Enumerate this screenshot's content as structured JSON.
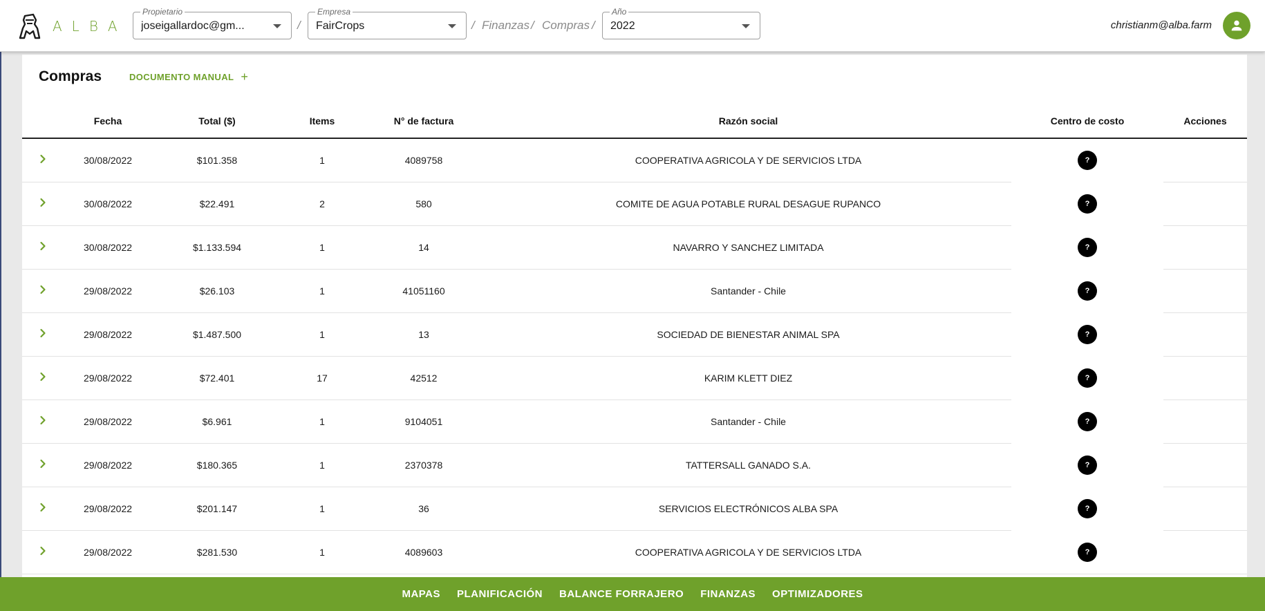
{
  "app": {
    "logo_text": "ALBA",
    "brand_color": "#6fa12b"
  },
  "header": {
    "owner": {
      "label": "Propietario",
      "value": "joseigallardoc@gm..."
    },
    "company": {
      "label": "Empresa",
      "value": "FairCrops"
    },
    "breadcrumb": [
      "Finanzas",
      "Compras"
    ],
    "year": {
      "label": "Año",
      "value": "2022"
    },
    "user_email": "christianm@alba.farm",
    "avatar_icon": "person-icon"
  },
  "page": {
    "title": "Compras",
    "manual_button": "DOCUMENTO MANUAL",
    "manual_button_icon": "+"
  },
  "table": {
    "columns": {
      "fecha": "Fecha",
      "total": "Total ($)",
      "items": "Items",
      "factura": "N° de factura",
      "razon": "Razón social",
      "centro": "Centro de costo",
      "acciones": "Acciones"
    },
    "cost_center_badge": "?",
    "rows": [
      {
        "fecha": "30/08/2022",
        "total": "$101.358",
        "items": "1",
        "factura": "4089758",
        "razon": "COOPERATIVA AGRICOLA Y DE SERVICIOS LTDA"
      },
      {
        "fecha": "30/08/2022",
        "total": "$22.491",
        "items": "2",
        "factura": "580",
        "razon": "COMITE DE AGUA POTABLE RURAL DESAGUE RUPANCO"
      },
      {
        "fecha": "30/08/2022",
        "total": "$1.133.594",
        "items": "1",
        "factura": "14",
        "razon": "NAVARRO Y SANCHEZ LIMITADA"
      },
      {
        "fecha": "29/08/2022",
        "total": "$26.103",
        "items": "1",
        "factura": "41051160",
        "razon": "Santander - Chile"
      },
      {
        "fecha": "29/08/2022",
        "total": "$1.487.500",
        "items": "1",
        "factura": "13",
        "razon": "SOCIEDAD DE BIENESTAR ANIMAL SPA"
      },
      {
        "fecha": "29/08/2022",
        "total": "$72.401",
        "items": "17",
        "factura": "42512",
        "razon": "KARIM KLETT DIEZ"
      },
      {
        "fecha": "29/08/2022",
        "total": "$6.961",
        "items": "1",
        "factura": "9104051",
        "razon": "Santander - Chile"
      },
      {
        "fecha": "29/08/2022",
        "total": "$180.365",
        "items": "1",
        "factura": "2370378",
        "razon": "TATTERSALL GANADO S.A."
      },
      {
        "fecha": "29/08/2022",
        "total": "$201.147",
        "items": "1",
        "factura": "36",
        "razon": "SERVICIOS ELECTRÓNICOS ALBA SPA"
      },
      {
        "fecha": "29/08/2022",
        "total": "$281.530",
        "items": "1",
        "factura": "4089603",
        "razon": "COOPERATIVA AGRICOLA Y DE SERVICIOS LTDA"
      }
    ]
  },
  "bottom_nav": [
    "MAPAS",
    "PLANIFICACIÓN",
    "BALANCE FORRAJERO",
    "FINANZAS",
    "OPTIMIZADORES"
  ]
}
